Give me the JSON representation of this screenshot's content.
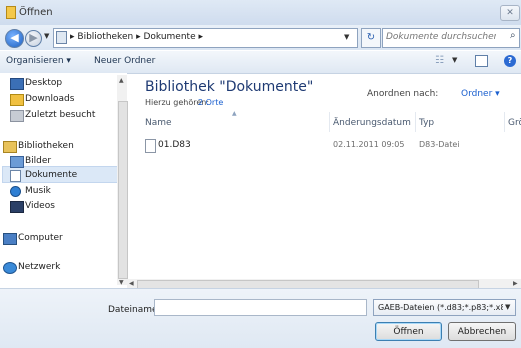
{
  "window": {
    "title": "Öffnen"
  },
  "address": {
    "path_segments": [
      "Bibliotheken",
      "Dokumente"
    ],
    "search_placeholder": "Dokumente durchsuchen"
  },
  "toolbar": {
    "organize_label": "Organisieren ▾",
    "newfolder_label": "Neuer Ordner"
  },
  "nav": {
    "items": [
      {
        "label": "Desktop",
        "icon": "desktop-icon"
      },
      {
        "label": "Downloads",
        "icon": "downloads-icon"
      },
      {
        "label": "Zuletzt besucht",
        "icon": "recent-icon"
      },
      {
        "label": "Bibliotheken",
        "icon": "libraries-icon"
      },
      {
        "label": "Bilder",
        "icon": "pictures-icon"
      },
      {
        "label": "Dokumente",
        "icon": "documents-icon",
        "selected": true
      },
      {
        "label": "Musik",
        "icon": "music-icon"
      },
      {
        "label": "Videos",
        "icon": "videos-icon"
      },
      {
        "label": "Computer",
        "icon": "computer-icon"
      },
      {
        "label": "Netzwerk",
        "icon": "network-icon"
      }
    ]
  },
  "content": {
    "title": "Bibliothek \"Dokumente\"",
    "include_label": "Hierzu gehören:",
    "include_link": "2 Orte",
    "arrange_label": "Anordnen nach:",
    "arrange_value": "Ordner ▾",
    "columns": [
      "Name",
      "Änderungsdatum",
      "Typ",
      "Grö"
    ],
    "files": [
      {
        "name": "01.D83",
        "date": "02.11.2011 09:05",
        "type": "D83-Datei"
      }
    ]
  },
  "bottom": {
    "filename_label": "Dateiname:",
    "filename_value": "",
    "filter_value": "GAEB-Dateien (*.d83;*.p83;*.x8:",
    "open_label": "Öffnen",
    "cancel_label": "Abbrechen"
  },
  "colors": {
    "accent": "#1a5fcf",
    "title_blue": "#1e3a73",
    "selection": "#dbe8f7"
  }
}
